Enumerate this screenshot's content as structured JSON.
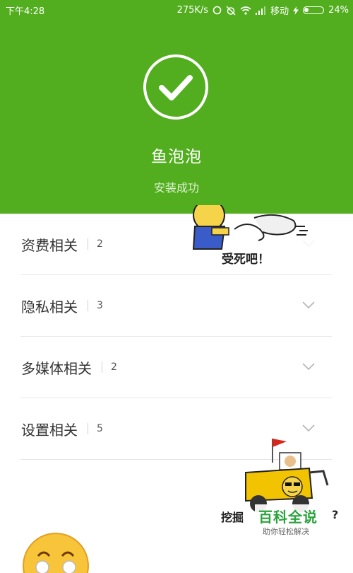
{
  "status_bar": {
    "time": "下午4:28",
    "speed": "275K/s",
    "carrier": "移动",
    "battery": "24%"
  },
  "install": {
    "app_name": "鱼泡泡",
    "status": "安装成功"
  },
  "categories": [
    {
      "label": "资费相关",
      "count": "2"
    },
    {
      "label": "隐私相关",
      "count": "3"
    },
    {
      "label": "多媒体相关",
      "count": "2"
    },
    {
      "label": "设置相关",
      "count": "5"
    }
  ],
  "stickers": {
    "top_caption": "受死吧！",
    "bottom_caption": "挖掘",
    "bottom_mark": "?"
  },
  "watermark": {
    "title": "百科全说",
    "subtitle": "助你轻松解决"
  },
  "colors": {
    "header_bg": "#52ae1e",
    "watermark_green": "#2aa33b"
  }
}
